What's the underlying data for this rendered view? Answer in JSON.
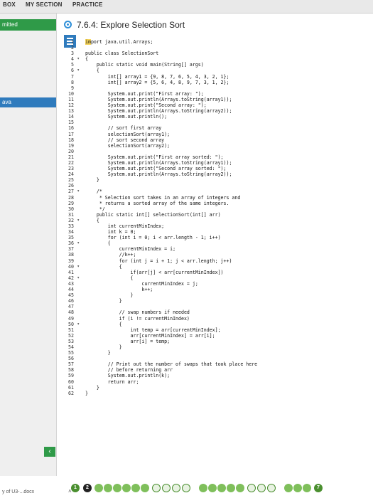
{
  "nav": {
    "tabs": [
      "BOX",
      "MY SECTION",
      "PRACTICE"
    ]
  },
  "sidebar": {
    "submitted": "mitted",
    "java": "ava"
  },
  "header": {
    "title": "7.6.4: Explore Selection Sort"
  },
  "editor": {
    "line_numbers": [
      "1",
      "2",
      "3",
      "4",
      "5",
      "6",
      "7",
      "8",
      "9",
      "10",
      "11",
      "12",
      "13",
      "14",
      "15",
      "16",
      "17",
      "18",
      "19",
      "20",
      "21",
      "22",
      "23",
      "24",
      "25",
      "26",
      "27",
      "28",
      "29",
      "30",
      "31",
      "32",
      "33",
      "34",
      "35",
      "36",
      "37",
      "38",
      "39",
      "40",
      "41",
      "42",
      "43",
      "44",
      "45",
      "46",
      "47",
      "48",
      "49",
      "50",
      "51",
      "52",
      "53",
      "54",
      "55",
      "56",
      "57",
      "58",
      "59",
      "60",
      "61",
      "62"
    ],
    "lines": [
      "import java.util.Arrays;",
      "",
      "public class SelectionSort",
      "{",
      "    public static void main(String[] args)",
      "    {",
      "        int[] array1 = {9, 8, 7, 6, 5, 4, 3, 2, 1};",
      "        int[] array2 = {5, 6, 4, 8, 9, 7, 3, 1, 2};",
      "",
      "        System.out.print(\"First array: \");",
      "        System.out.println(Arrays.toString(array1));",
      "        System.out.print(\"Second array: \");",
      "        System.out.println(Arrays.toString(array2));",
      "        System.out.println();",
      "",
      "        // sort first array",
      "        selectionSort(array1);",
      "        // sort second array",
      "        selectionSort(array2);",
      "",
      "        System.out.print(\"First array sorted: \");",
      "        System.out.println(Arrays.toString(array1));",
      "        System.out.print(\"Second array sorted: \");",
      "        System.out.println(Arrays.toString(array2));",
      "    }",
      "",
      "    /*",
      "     * Selection sort takes in an array of integers and",
      "     * returns a sorted array of the same integers.",
      "     */",
      "    public static int[] selectionSort(int[] arr)",
      "    {",
      "        int currentMinIndex;",
      "        int k = 0;",
      "        for (int i = 0; i < arr.length - 1; i++)",
      "        {",
      "            currentMinIndex = i;",
      "            //k++;",
      "            for (int j = i + 1; j < arr.length; j++)",
      "            {",
      "                if(arr[j] < arr[currentMinIndex])",
      "                {",
      "                    currentMinIndex = j;",
      "                    k++;",
      "                }",
      "            }",
      "",
      "            // swap numbers if needed",
      "            if (i != currentMinIndex)",
      "            {",
      "                int temp = arr[currentMinIndex];",
      "                arr[currentMinIndex] = arr[i];",
      "                arr[i] = temp;",
      "            }",
      "        }",
      "",
      "        // Print out the number of swaps that took place here",
      "        // before returning arr",
      "        System.out.println(k);",
      "        return arr;",
      "    }",
      "}"
    ]
  },
  "pagination": {
    "first": "1",
    "second": "2",
    "last": "7"
  },
  "taskbar": {
    "file": "y of U3-...docx"
  },
  "colors": {
    "accent_green": "#2f9a48",
    "accent_blue": "#2f7bbd",
    "highlight": "#f6d55c"
  }
}
